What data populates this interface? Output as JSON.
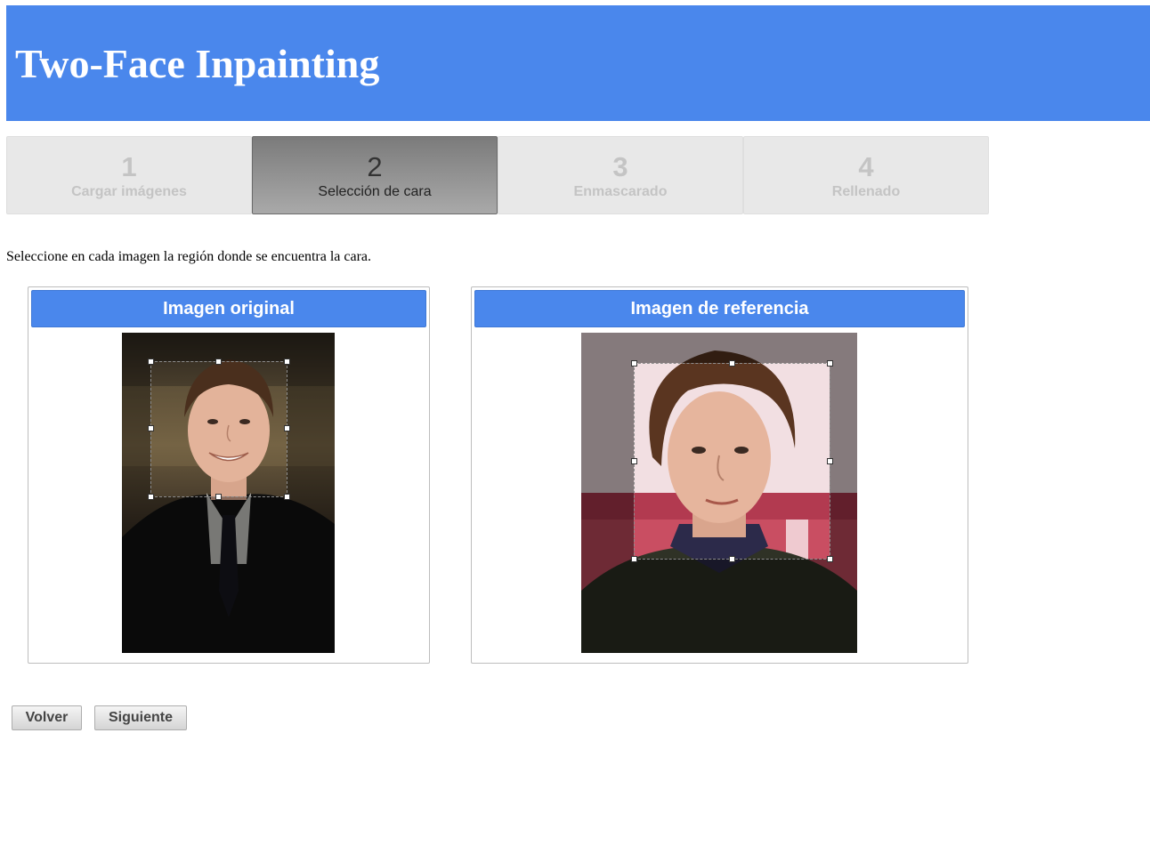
{
  "header": {
    "title": "Two-Face Inpainting"
  },
  "steps": [
    {
      "number": "1",
      "label": "Cargar imágenes",
      "state": "inactive"
    },
    {
      "number": "2",
      "label": "Selección de cara",
      "state": "active"
    },
    {
      "number": "3",
      "label": "Enmascarado",
      "state": "inactive"
    },
    {
      "number": "4",
      "label": "Rellenado",
      "state": "inactive"
    }
  ],
  "instructions": "Seleccione en cada imagen la región donde se encuentra la cara.",
  "panels": {
    "original": {
      "title": "Imagen original"
    },
    "reference": {
      "title": "Imagen de referencia"
    }
  },
  "buttons": {
    "back": "Volver",
    "next": "Siguiente"
  },
  "colors": {
    "accent": "#4a87ec",
    "active_step": "#8f8f8f",
    "inactive_text": "#c4c4c4"
  }
}
